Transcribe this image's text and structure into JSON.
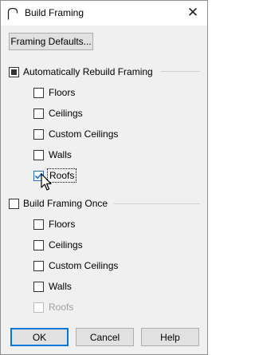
{
  "window": {
    "title": "Build Framing",
    "close_glyph": "✕"
  },
  "toolbar": {
    "framing_defaults_label": "Framing Defaults..."
  },
  "auto_rebuild": {
    "label": "Automatically Rebuild Framing",
    "state": "indeterminate",
    "items": [
      {
        "label": "Floors",
        "checked": false,
        "disabled": false
      },
      {
        "label": "Ceilings",
        "checked": false,
        "disabled": false
      },
      {
        "label": "Custom Ceilings",
        "checked": false,
        "disabled": false
      },
      {
        "label": "Walls",
        "checked": false,
        "disabled": false
      },
      {
        "label": "Roofs",
        "checked": true,
        "disabled": false
      }
    ]
  },
  "build_once": {
    "label": "Build Framing Once",
    "checked": false,
    "items": [
      {
        "label": "Floors",
        "checked": false,
        "disabled": false
      },
      {
        "label": "Ceilings",
        "checked": false,
        "disabled": false
      },
      {
        "label": "Custom Ceilings",
        "checked": false,
        "disabled": false
      },
      {
        "label": "Walls",
        "checked": false,
        "disabled": false
      },
      {
        "label": "Roofs",
        "checked": false,
        "disabled": true
      }
    ]
  },
  "buttons": {
    "ok": "OK",
    "cancel": "Cancel",
    "help": "Help"
  },
  "colors": {
    "accent": "#0078d7",
    "dialog_bg": "#f0f0f0",
    "button_bg": "#e1e1e1",
    "disabled_text": "#a0a0a0"
  },
  "icons": {
    "app": "arch-icon",
    "close": "close-icon",
    "cursor": "mouse-pointer-icon",
    "check": "checkmark-icon"
  }
}
